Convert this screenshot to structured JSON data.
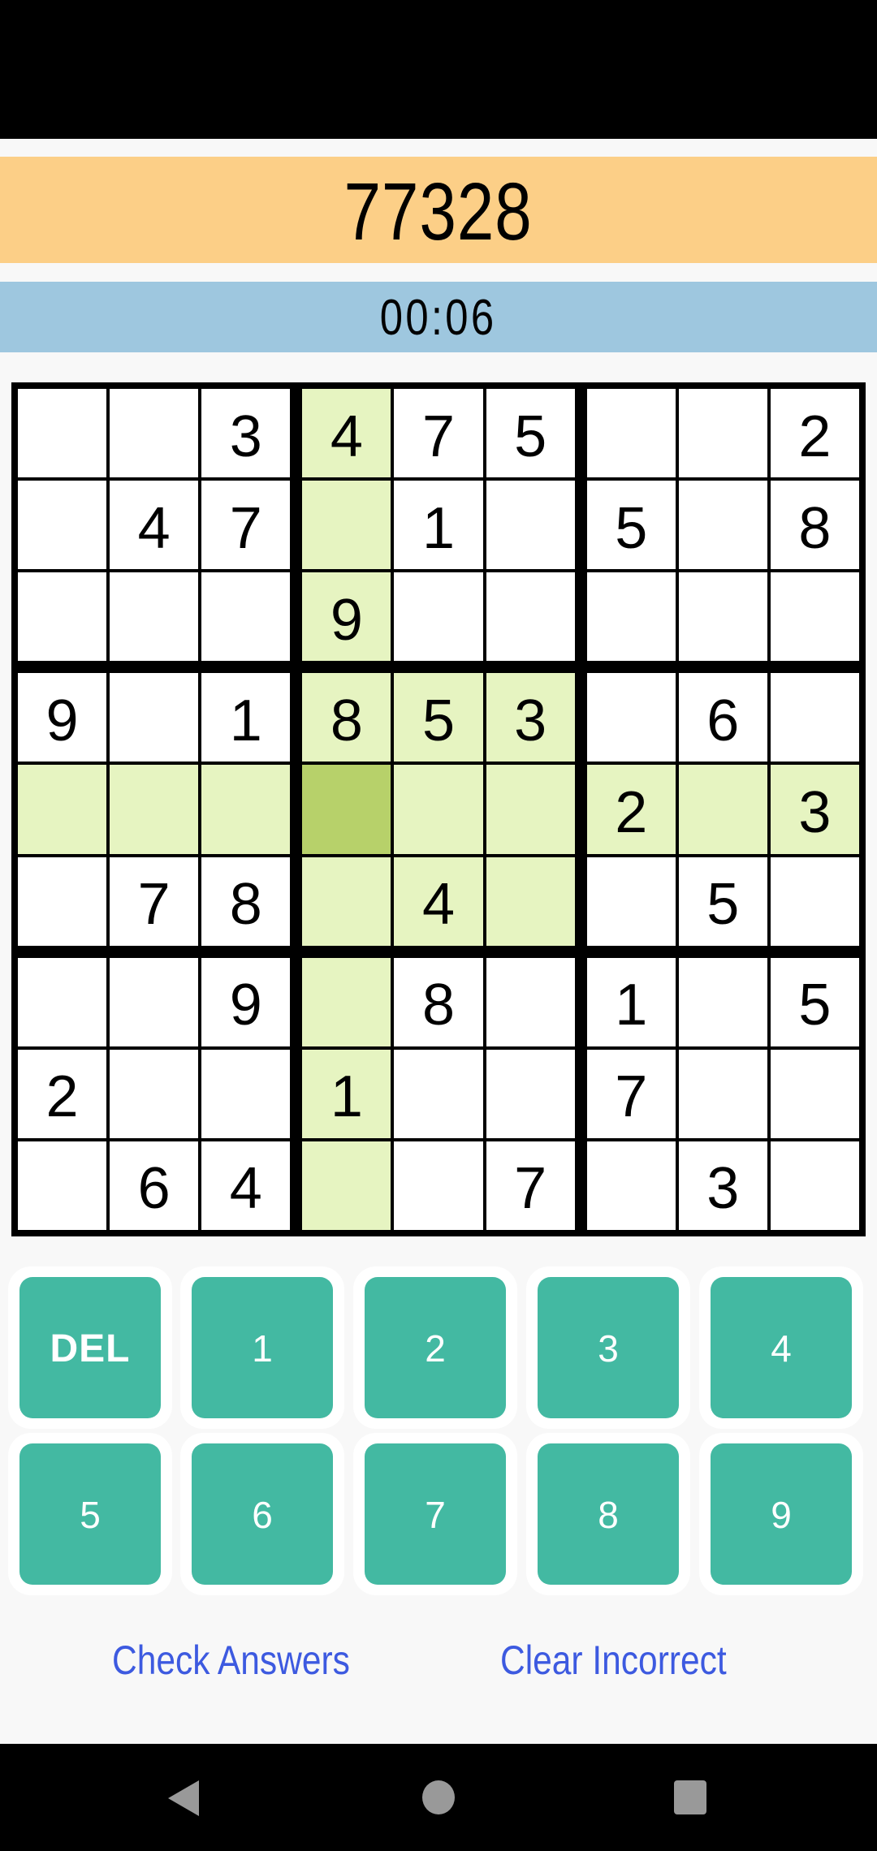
{
  "header": {
    "puzzle_id": "77328",
    "timer": "00:06"
  },
  "board": {
    "selected": {
      "row": 4,
      "col": 3
    },
    "rows": [
      [
        "",
        "",
        "3",
        "4",
        "7",
        "5",
        "",
        "",
        "2"
      ],
      [
        "",
        "4",
        "7",
        "",
        "1",
        "",
        "5",
        "",
        "8"
      ],
      [
        "",
        "",
        "",
        "9",
        "",
        "",
        "",
        "",
        ""
      ],
      [
        "9",
        "",
        "1",
        "8",
        "5",
        "3",
        "",
        "6",
        ""
      ],
      [
        "",
        "",
        "",
        "",
        "",
        "",
        "2",
        "",
        "3"
      ],
      [
        "",
        "7",
        "8",
        "",
        "4",
        "",
        "",
        "5",
        ""
      ],
      [
        "",
        "",
        "9",
        "",
        "8",
        "",
        "1",
        "",
        "5"
      ],
      [
        "2",
        "",
        "",
        "1",
        "",
        "",
        "7",
        "",
        ""
      ],
      [
        "",
        "6",
        "4",
        "",
        "",
        "7",
        "",
        "3",
        ""
      ]
    ]
  },
  "keypad": {
    "keys": [
      "DEL",
      "1",
      "2",
      "3",
      "4",
      "5",
      "6",
      "7",
      "8",
      "9"
    ]
  },
  "actions": {
    "check_answers": "Check Answers",
    "clear_incorrect": "Clear Incorrect"
  },
  "nav_bar": {
    "icons": [
      "back-icon",
      "home-icon",
      "recents-icon"
    ]
  },
  "colors": {
    "puzzle_band": "#fccf87",
    "timer_band": "#9ec7df",
    "highlight": "#e6f4c1",
    "selected": "#b7d16a",
    "key": "#43b9a2",
    "link": "#3d5ae0"
  }
}
